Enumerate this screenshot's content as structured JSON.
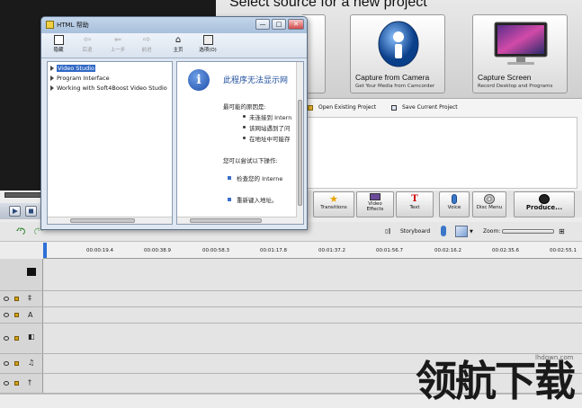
{
  "hero": {
    "title": "Select source for a new project",
    "cards": [
      {
        "title": "Capture from Camera",
        "subtitle": "Get Your Media from Camcorder"
      },
      {
        "title": "Capture Screen",
        "subtitle": "Record Desktop and Programs"
      }
    ]
  },
  "links": {
    "open_existing": "Open Existing Project",
    "save_current": "Save Current Project"
  },
  "toolbar": {
    "transitions": "Transitions",
    "video_effects_1": "Video",
    "video_effects_2": "Effects",
    "text": "Text",
    "voice": "Voice",
    "disc_menu": "Disc Menu",
    "produce": "Produce..."
  },
  "timeline": {
    "storyboard": "Storyboard",
    "zoom": "Zoom:",
    "ticks": [
      "00:00:19.4",
      "00:00:38.9",
      "00:00:58.3",
      "00:01:17.8",
      "00:01:37.2",
      "00:01:56.7",
      "00:02:16.2",
      "00:02:35.6",
      "00:02:55.1"
    ],
    "tracks": [
      "A"
    ]
  },
  "help_window": {
    "title": "HTML 帮助",
    "controls": {
      "minimize": "—",
      "maximize": "□",
      "close": "✕"
    },
    "toolbar": [
      {
        "label": "隐藏",
        "enabled": true
      },
      {
        "label": "后退",
        "enabled": false
      },
      {
        "label": "上一步",
        "enabled": false
      },
      {
        "label": "前进",
        "enabled": false
      },
      {
        "label": "主页",
        "enabled": true
      },
      {
        "label": "选项(O)",
        "enabled": true
      }
    ],
    "tree": [
      "Video Studio",
      "Program Interface",
      "Working with Soft4Boost Video Studio"
    ],
    "content": {
      "heading": "此程序无法显示网",
      "reasons_title": "最可能的原因是:",
      "reasons": [
        "未连接到 Intern",
        "该网站遇到了问",
        "在地址中可能存"
      ],
      "actions_title": "您可以尝试以下操作:",
      "actions": [
        "检查您的 Interne",
        "重新键入地址。"
      ]
    }
  },
  "watermark": {
    "text": "领航下载",
    "url": "lhdown.com"
  }
}
